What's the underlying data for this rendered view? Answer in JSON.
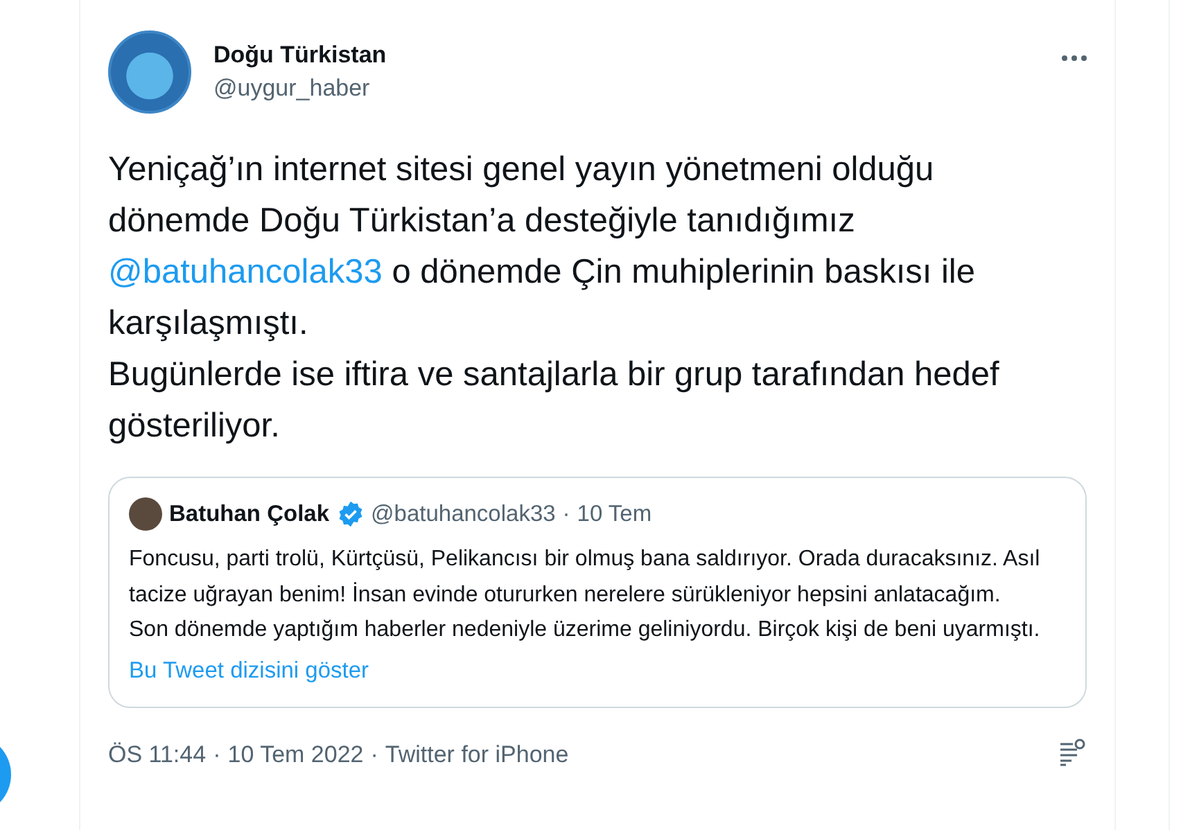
{
  "author": {
    "name": "Doğu Türkistan",
    "handle": "@uygur_haber"
  },
  "body": [
    {
      "kind": "text",
      "text": "Yeniçağ’ın internet sitesi genel yayın yönetmeni olduğu dönemde Doğu Türkistan’a desteğiyle tanıdığımız "
    },
    {
      "kind": "mention",
      "text": "@batuhancolak33"
    },
    {
      "kind": "text",
      "text": " o dönemde Çin muhiplerinin baskısı ile karşılaşmıştı.\nBugünlerde ise iftira ve santajlarla bir grup tarafından hedef gösteriliyor."
    }
  ],
  "quote": {
    "name": "Batuhan Çolak",
    "verified": true,
    "handle": "@batuhancolak33",
    "separator": "·",
    "date": "10 Tem",
    "text": "Foncusu, parti trolü, Kürtçüsü, Pelikancısı bir olmuş bana saldırıyor. Orada duracaksınız. Asıl tacize uğrayan benim! İnsan evinde otururken nerelere sürükleniyor hepsini anlatacağım.\nSon dönemde yaptığım haberler nedeniyle üzerime geliniyordu. Birçok kişi de beni uyarmıştı.",
    "link": "Bu Tweet dizisini göster"
  },
  "footer": {
    "time": "ÖS 11:44",
    "sep1": "·",
    "date": "10 Tem 2022",
    "sep2": "·",
    "source": "Twitter for iPhone"
  }
}
